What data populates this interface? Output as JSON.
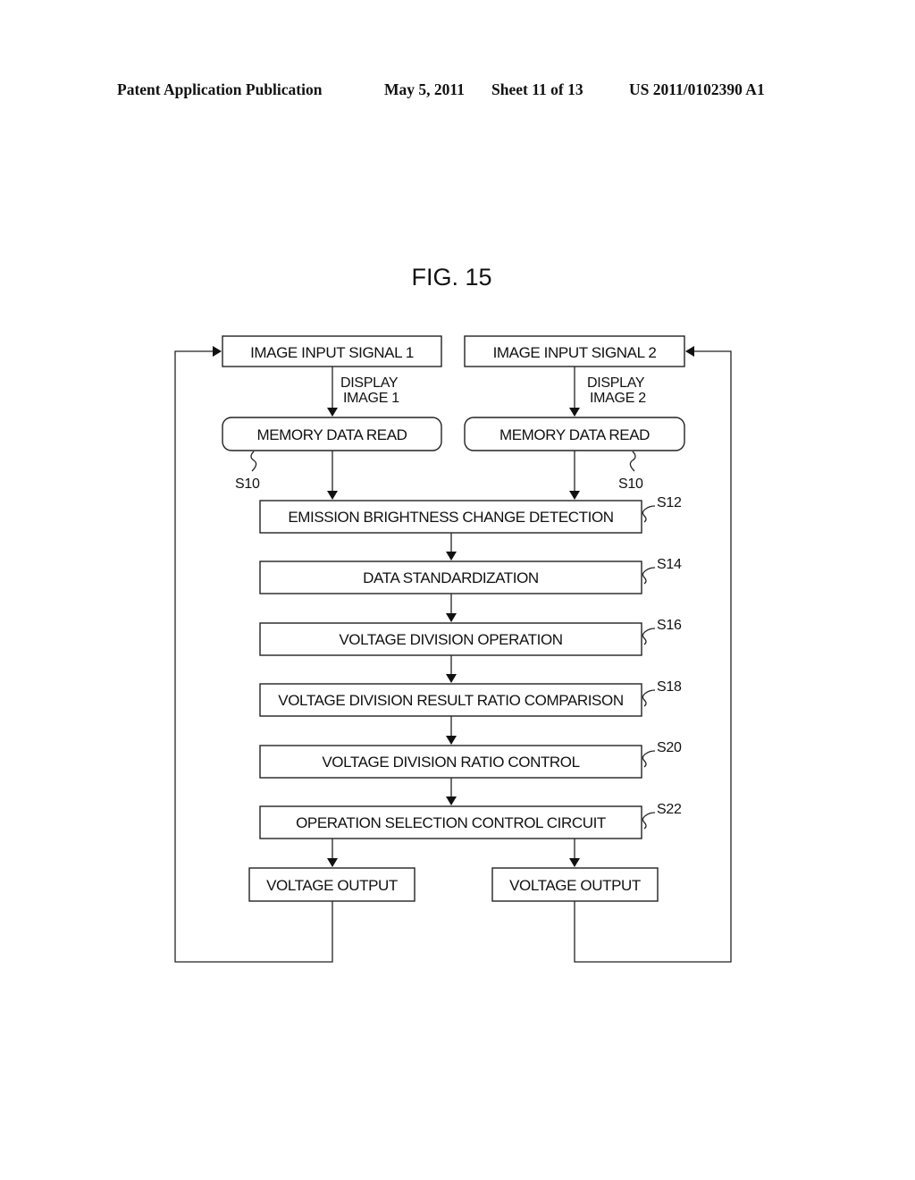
{
  "header": {
    "publication": "Patent Application Publication",
    "date": "May 5, 2011",
    "sheet": "Sheet 11 of 13",
    "number": "US 2011/0102390 A1"
  },
  "figure": {
    "title": "FIG. 15"
  },
  "nodes": {
    "input1": "IMAGE INPUT SIGNAL 1",
    "input2": "IMAGE INPUT SIGNAL 2",
    "display1_line1": "DISPLAY",
    "display1_line2": "IMAGE 1",
    "display2_line1": "DISPLAY",
    "display2_line2": "IMAGE 2",
    "memory1": "MEMORY DATA READ",
    "memory2": "MEMORY DATA READ",
    "s12": "EMISSION BRIGHTNESS CHANGE DETECTION",
    "s14": "DATA STANDARDIZATION",
    "s16": "VOLTAGE DIVISION OPERATION",
    "s18": "VOLTAGE DIVISION RESULT RATIO COMPARISON",
    "s20": "VOLTAGE DIVISION RATIO CONTROL",
    "s22": "OPERATION SELECTION CONTROL CIRCUIT",
    "out1": "VOLTAGE OUTPUT",
    "out2": "VOLTAGE OUTPUT"
  },
  "step_labels": {
    "s10_left": "S10",
    "s10_right": "S10",
    "s12": "S12",
    "s14": "S14",
    "s16": "S16",
    "s18": "S18",
    "s20": "S20",
    "s22": "S22"
  }
}
